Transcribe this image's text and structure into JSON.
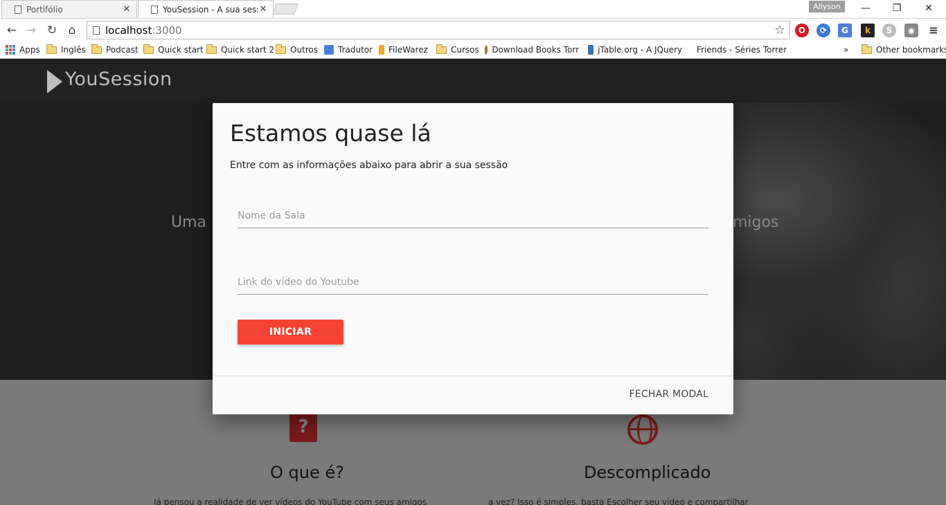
{
  "browser": {
    "tabs": [
      {
        "title": "Portifólio",
        "active": false
      },
      {
        "title": "YouSession - A sua sessão",
        "active": true
      }
    ],
    "user": "Allyson",
    "url_host": "localhost",
    "url_port": ":3000",
    "bookmarks": [
      {
        "label": "Apps",
        "icon": "apps-grid-icon"
      },
      {
        "label": "Inglês",
        "icon": "folder-icon"
      },
      {
        "label": "Podcast",
        "icon": "folder-icon"
      },
      {
        "label": "Quick start",
        "icon": "folder-icon"
      },
      {
        "label": "Quick start 2",
        "icon": "folder-icon"
      },
      {
        "label": "Outros",
        "icon": "folder-icon"
      },
      {
        "label": "Tradutor",
        "icon": "translate-icon"
      },
      {
        "label": "FileWarez",
        "icon": "filewarez-icon"
      },
      {
        "label": "Cursos",
        "icon": "folder-icon"
      },
      {
        "label": "Download Books Torr",
        "icon": "shield-icon"
      },
      {
        "label": "jTable.org - A JQuery",
        "icon": "jtable-icon"
      },
      {
        "label": "Friends - Séries Torren",
        "icon": "site-icon"
      }
    ],
    "more_bookmarks": "»",
    "other_bookmarks": "Other bookmarks"
  },
  "site": {
    "brand": "YouSession",
    "hero_left": "Uma r",
    "hero_right": "migos",
    "features": [
      {
        "title": "O que é?",
        "text": "Já pensou a realidade de ver vídeos do YouTube com seus amigos"
      },
      {
        "title": "Descomplicado",
        "text": "a vez? Isso é simples, basta Escolher seu vídeo e compartilhar"
      }
    ]
  },
  "modal": {
    "title": "Estamos quase lá",
    "subtitle": "Entre com as informações abaixo para abrir a sua sessão",
    "room_placeholder": "Nome da Sala",
    "video_placeholder": "Link do vídeo do Youtube",
    "start_label": "INICIAR",
    "close_label": "FECHAR MODAL"
  },
  "colors": {
    "accent": "#f44336",
    "navbar": "#222222",
    "icon_red": "#7b1b1b"
  }
}
